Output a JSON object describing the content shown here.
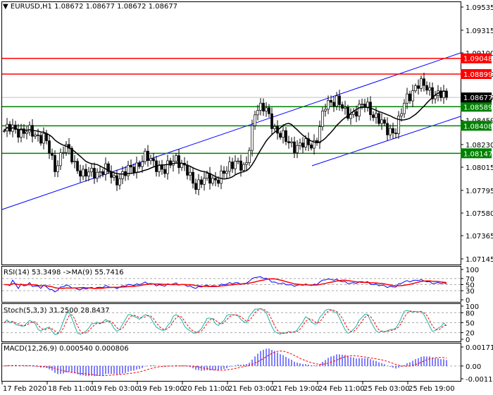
{
  "header": {
    "symbol": "EURUSD,H1",
    "ohlc": "1.08672 1.08677 1.08672 1.08677"
  },
  "price_axis": {
    "ticks": [
      "1.09535",
      "1.09315",
      "1.09100",
      "1.08899",
      "1.08677",
      "1.08459",
      "1.08230",
      "1.08015",
      "1.07795",
      "1.07580",
      "1.07365",
      "1.07145"
    ]
  },
  "levels": [
    {
      "label": "1.09048",
      "price": 1.09048,
      "color": "#ff0000"
    },
    {
      "label": "1.08899",
      "price": 1.08899,
      "color": "#ff0000"
    },
    {
      "label": "1.08589",
      "price": 1.08589,
      "color": "#008000"
    },
    {
      "label": "1.08408",
      "price": 1.08408,
      "color": "#008000"
    },
    {
      "label": "1.08147",
      "price": 1.08147,
      "color": "#008000"
    }
  ],
  "current_price": {
    "label": "1.08677",
    "price": 1.08677
  },
  "indicators": {
    "rsi": {
      "label": "RSI(14) 53.3498  ->MA(9) 55.7416",
      "ticks": [
        "100",
        "70",
        "50",
        "30",
        "0"
      ]
    },
    "stoch": {
      "label": "Stoch(5,3,3) 31.2500 28.8437",
      "ticks": [
        "100",
        "80",
        "50",
        "20",
        "0"
      ]
    },
    "macd": {
      "label": "MACD(12,26,9) 0.000540 0.000806",
      "ticks": [
        "0.001718",
        "0.00",
        "-0.00116"
      ]
    }
  },
  "time_axis": [
    "17 Feb 2020",
    "18 Feb 11:00",
    "19 Feb 03:00",
    "19 Feb 19:00",
    "20 Feb 11:00",
    "21 Feb 03:00",
    "21 Feb 19:00",
    "24 Feb 11:00",
    "25 Feb 03:00",
    "25 Feb 19:00"
  ],
  "chart_data": {
    "type": "candlestick",
    "timeframe": "H1",
    "close_keypoints": [
      1.0836,
      1.0838,
      1.0835,
      1.0833,
      1.083,
      1.08,
      1.0822,
      1.0805,
      1.0793,
      1.0797,
      1.0799,
      1.079,
      1.0795,
      1.0803,
      1.081,
      1.0806,
      1.0796,
      1.0813,
      1.0798,
      1.0786,
      1.0789,
      1.0791,
      1.0795,
      1.081,
      1.0796,
      1.086,
      1.0855,
      1.0838,
      1.0826,
      1.0822,
      1.0822,
      1.0826,
      1.086,
      1.0868,
      1.085,
      1.0856,
      1.086,
      1.085,
      1.0836,
      1.0838,
      1.0866,
      1.088,
      1.0877,
      1.087,
      1.0868
    ],
    "ma_period": 14,
    "ylim": [
      1.07145,
      1.09535
    ]
  },
  "colors": {
    "rsi": "#0000ff",
    "rsi_ma": "#ff0000",
    "stoch_main": "#20b2aa",
    "stoch_signal": "#ff0000",
    "macd_hist": "#0000ff",
    "macd_signal": "#ff0000"
  }
}
